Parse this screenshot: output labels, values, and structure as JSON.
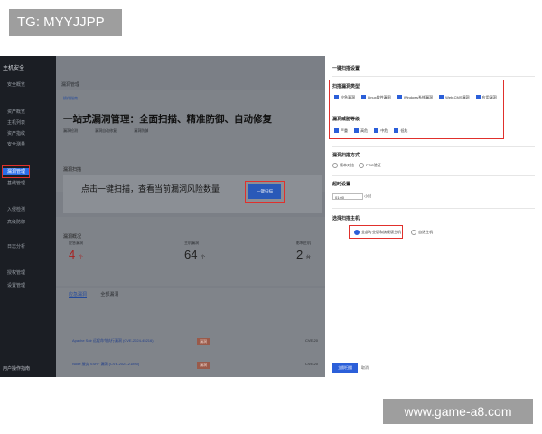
{
  "overlay": {
    "tag": "TG: MYYJJPP",
    "watermark": "www.game-a8.com"
  },
  "sidebar": {
    "brand": "主机安全",
    "items": [
      {
        "label": "安全概览"
      },
      {
        "label": "资产概览"
      },
      {
        "label": "主机列表"
      },
      {
        "label": "资产指纹"
      },
      {
        "label": "安全测量"
      },
      {
        "label": "漏洞管理"
      },
      {
        "label": "基线管理"
      },
      {
        "label": "入侵检测"
      },
      {
        "label": "高级防御"
      },
      {
        "label": "日志分析"
      },
      {
        "label": "授权管理"
      },
      {
        "label": "设置管理"
      }
    ],
    "footer": "用户操作指南"
  },
  "main": {
    "breadcrumb": "漏洞管理",
    "small_link": "操作指南",
    "headline": "一站式漏洞管理：全面扫描、精准防御、自动修复",
    "subtabs": [
      "漏洞检测",
      "漏洞自动修复",
      "漏洞防御"
    ],
    "scan_title": "漏洞扫描",
    "scan_big": "点击一键扫描，查看当前漏洞风险数量",
    "scan_button": "一键扫描",
    "overview_title": "漏洞概况",
    "stats": [
      {
        "label": "应急漏洞",
        "value": "4",
        "unit": "个"
      },
      {
        "label": "主机漏洞",
        "value": "64",
        "unit": "个"
      },
      {
        "label": "影响主机",
        "value": "2",
        "unit": "台"
      }
    ],
    "table_tabs": [
      "应急漏洞",
      "全部漏洞"
    ],
    "table_rows": [
      {
        "name": "Apache Solr 远程命令执行漏洞 (CVE-2024-45216)",
        "tag": "漏洞",
        "cve": "CVE-20"
      },
      {
        "name": "Node 服务 SSRF 漏洞 (CVE-2024-21890)",
        "tag": "漏洞",
        "cve": "CVE-20"
      }
    ]
  },
  "panel": {
    "title": "一键扫描设置",
    "scan_types_label": "扫描漏洞类型",
    "scan_types": [
      "应急漏洞",
      "Linux软件漏洞",
      "Windows系统漏洞",
      "Web-CMS漏洞",
      "应用漏洞"
    ],
    "severity_label": "漏洞威胁等级",
    "severities": [
      "严重",
      "高危",
      "中危",
      "低危"
    ],
    "method_label": "漏洞扫描方式",
    "methods": [
      "版本对比",
      "POC验证"
    ],
    "timeout_label": "超时设置",
    "timeout_value": "01:00",
    "timeout_suffix": "小时",
    "hosts_label": "选择扫描主机",
    "hosts_options": [
      "全部专业版和旗舰版主机",
      "自选主机"
    ],
    "confirm": "立即扫描",
    "cancel": "取消"
  }
}
